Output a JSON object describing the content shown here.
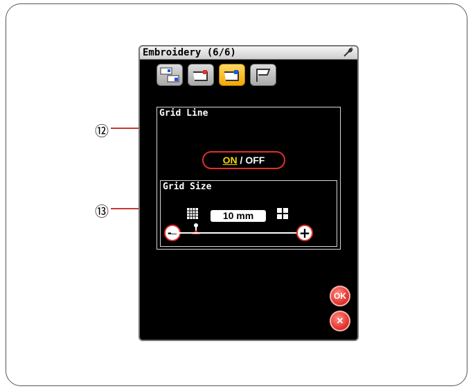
{
  "window": {
    "title": "Embroidery (6/6)"
  },
  "tabs": [
    {
      "name": "tab-machine-settings"
    },
    {
      "name": "tab-thread-settings"
    },
    {
      "name": "tab-embroidery-settings"
    },
    {
      "name": "tab-flag"
    }
  ],
  "grid_line": {
    "label": "Grid Line",
    "on_label": "ON",
    "separator": "/",
    "off_label": "OFF"
  },
  "grid_size": {
    "label": "Grid Size",
    "value": "10  mm",
    "minus": "−",
    "plus": "+"
  },
  "buttons": {
    "ok_label": "OK",
    "cancel_label": "×"
  },
  "callouts": {
    "grid_line": "⑫",
    "grid_size": "⑬"
  },
  "colors": {
    "screen_bg": "#000000",
    "accent_red": "#e0302a",
    "on_yellow": "#f2d800",
    "active_tab": "#f2a900"
  }
}
